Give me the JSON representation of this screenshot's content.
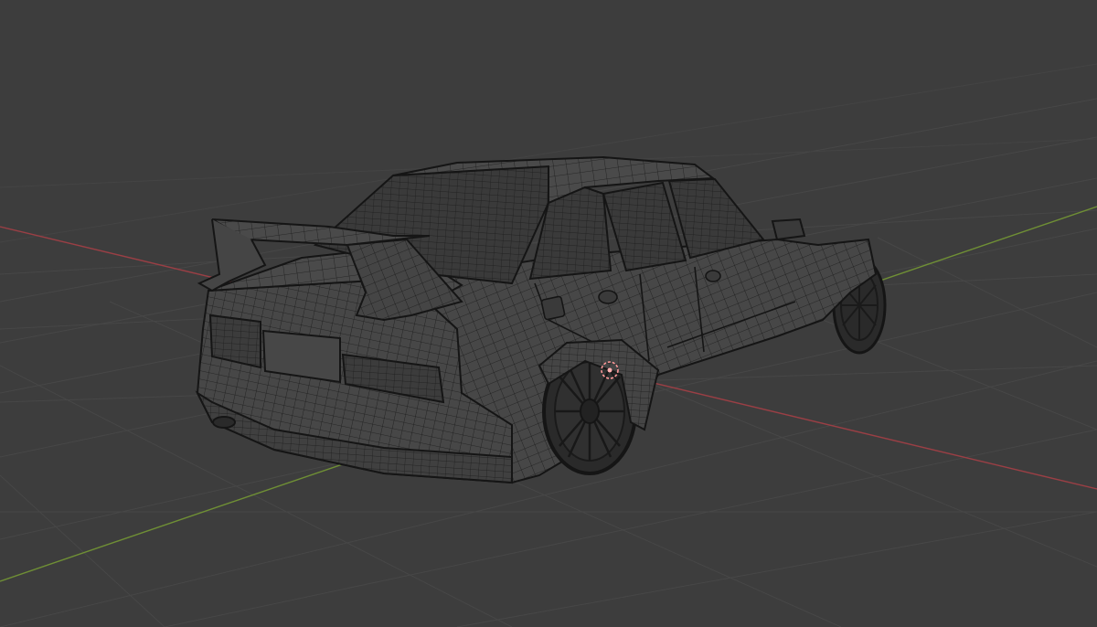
{
  "viewport": {
    "mode": "wireframe",
    "colors": {
      "background": "#3d3d3d",
      "grid_line": "#4a4a4a",
      "axis_x": "#9a3f45",
      "axis_y": "#6f8f35",
      "wire": "#1a1a1a",
      "body_fill": "#474747",
      "window_fill": "#3a3a3a",
      "origin_marker": "#ff9a9a"
    },
    "object": {
      "type": "car-mesh",
      "view": "rear-three-quarter"
    },
    "icons": {
      "origin": "object-origin-icon",
      "car": "car-mesh-icon"
    }
  }
}
